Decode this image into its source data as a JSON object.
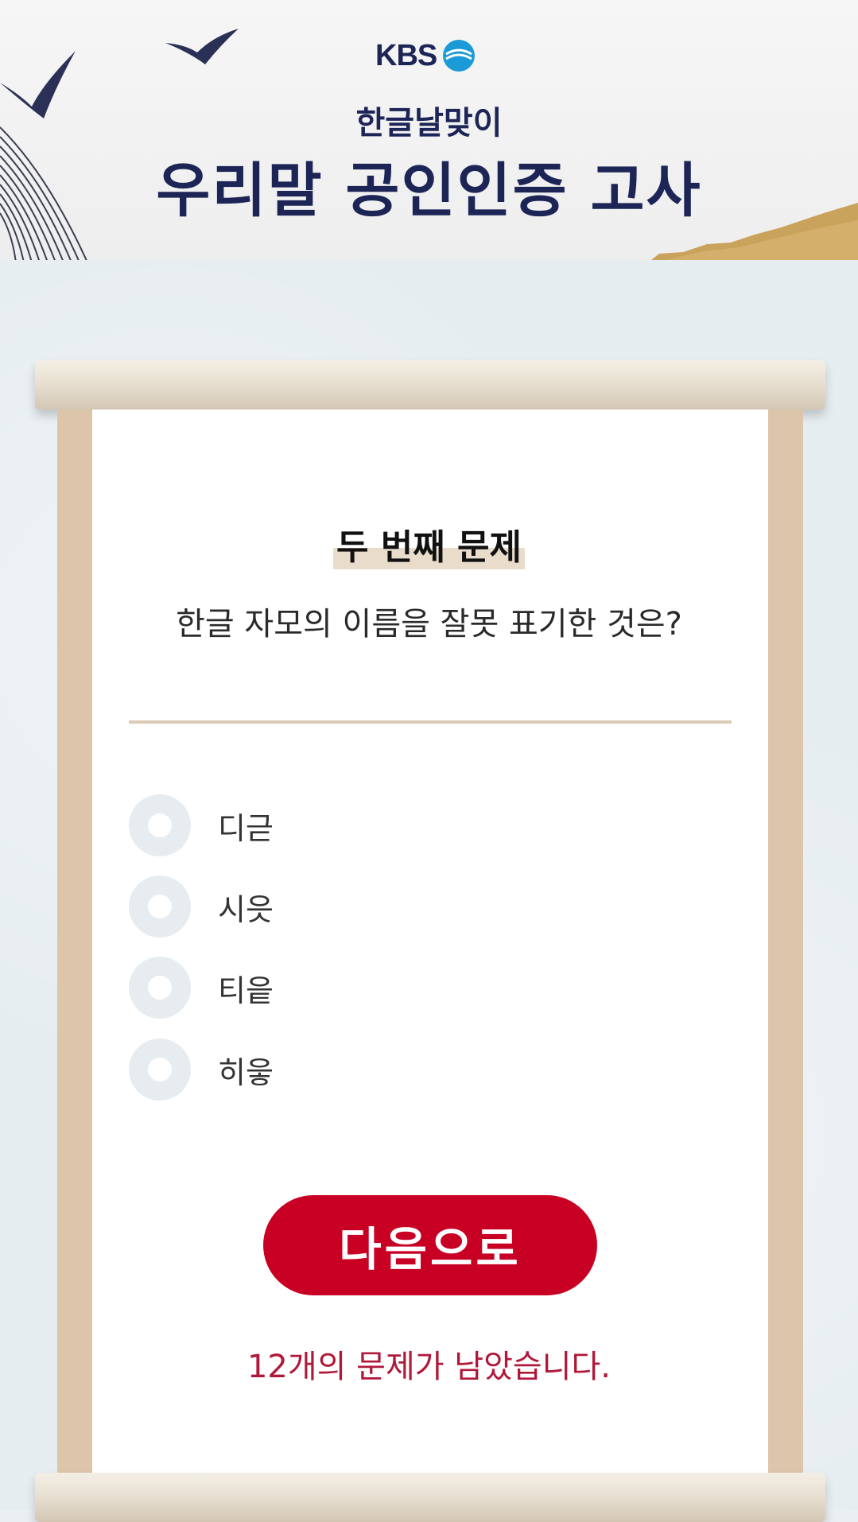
{
  "header": {
    "logo_text": "KBS",
    "subtitle": "한글날맞이",
    "title": "우리말 공인인증 고사"
  },
  "quiz": {
    "question_label": "두 번째 문제",
    "question_text": "한글 자모의 이름을 잘못 표기한 것은?",
    "options": [
      {
        "label": "디귿"
      },
      {
        "label": "시읏"
      },
      {
        "label": "티읕"
      },
      {
        "label": "히읗"
      }
    ],
    "next_button_label": "다음으로",
    "remaining_text": "12개의 문제가 남았습니다."
  },
  "colors": {
    "navy": "#1d2557",
    "accent_red": "#c80024",
    "remaining_text": "#b0183a",
    "rail": "#dcc5a9"
  }
}
